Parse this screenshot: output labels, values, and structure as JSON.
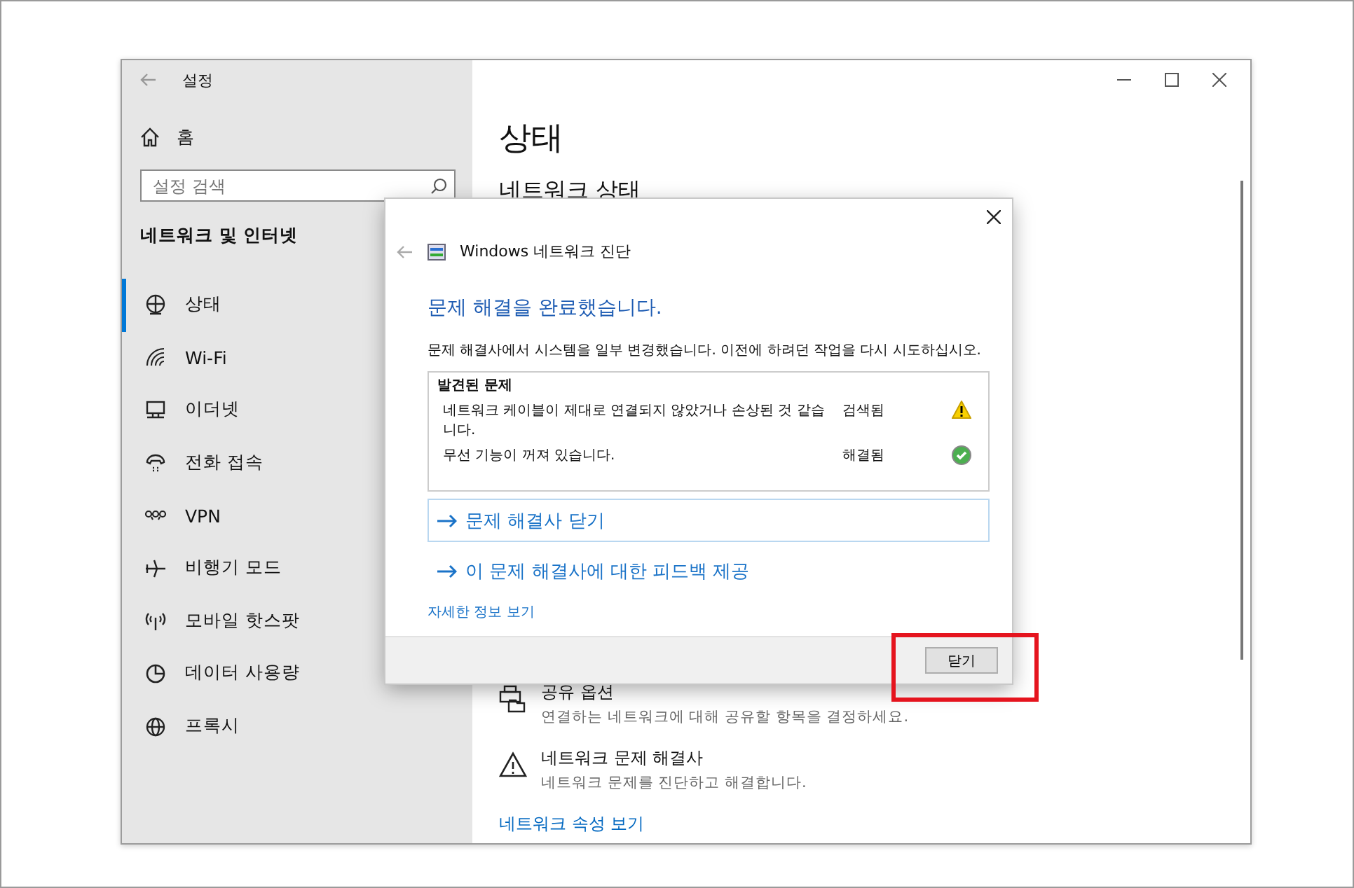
{
  "window": {
    "title": "설정"
  },
  "sidebar": {
    "home": "홈",
    "search": {
      "placeholder": "설정 검색"
    },
    "section_title": "네트워크 및 인터넷",
    "items": [
      {
        "label": "상태",
        "selected": true
      },
      {
        "label": "Wi-Fi",
        "selected": false
      },
      {
        "label": "이더넷",
        "selected": false
      },
      {
        "label": "전화 접속",
        "selected": false
      },
      {
        "label": "VPN",
        "selected": false
      },
      {
        "label": "비행기 모드",
        "selected": false
      },
      {
        "label": "모바일 핫스팟",
        "selected": false
      },
      {
        "label": "데이터 사용량",
        "selected": false
      },
      {
        "label": "프록시",
        "selected": false
      }
    ]
  },
  "main": {
    "title": "상태",
    "subtitle": "네트워크 상태",
    "options": [
      {
        "title": "공유 옵션",
        "description": "연결하는 네트워크에 대해 공유할 항목을 결정하세요."
      },
      {
        "title": "네트워크 문제 해결사",
        "description": "네트워크 문제를 진단하고 해결합니다."
      }
    ],
    "link": "네트워크 속성 보기"
  },
  "dialog": {
    "title": "Windows 네트워크 진단",
    "heading": "문제 해결을 완료했습니다.",
    "message": "문제 해결사에서 시스템을 일부 변경했습니다. 이전에 하려던 작업을 다시 시도하십시오.",
    "problems": {
      "header": "발견된 문제",
      "rows": [
        {
          "text": "네트워크 케이블이 제대로 연결되지 않았거나 손상된 것 같습니다.",
          "status": "검색됨",
          "kind": "warning"
        },
        {
          "text": "무선 기능이 꺼져 있습니다.",
          "status": "해결됨",
          "kind": "resolved"
        }
      ]
    },
    "actions": [
      {
        "label": "문제 해결사 닫기",
        "selected": true
      },
      {
        "label": "이 문제 해결사에 대한 피드백 제공",
        "selected": false
      }
    ],
    "details_link": "자세한 정보 보기",
    "close_button": {
      "label": "닫기",
      "highlighted": true
    }
  }
}
